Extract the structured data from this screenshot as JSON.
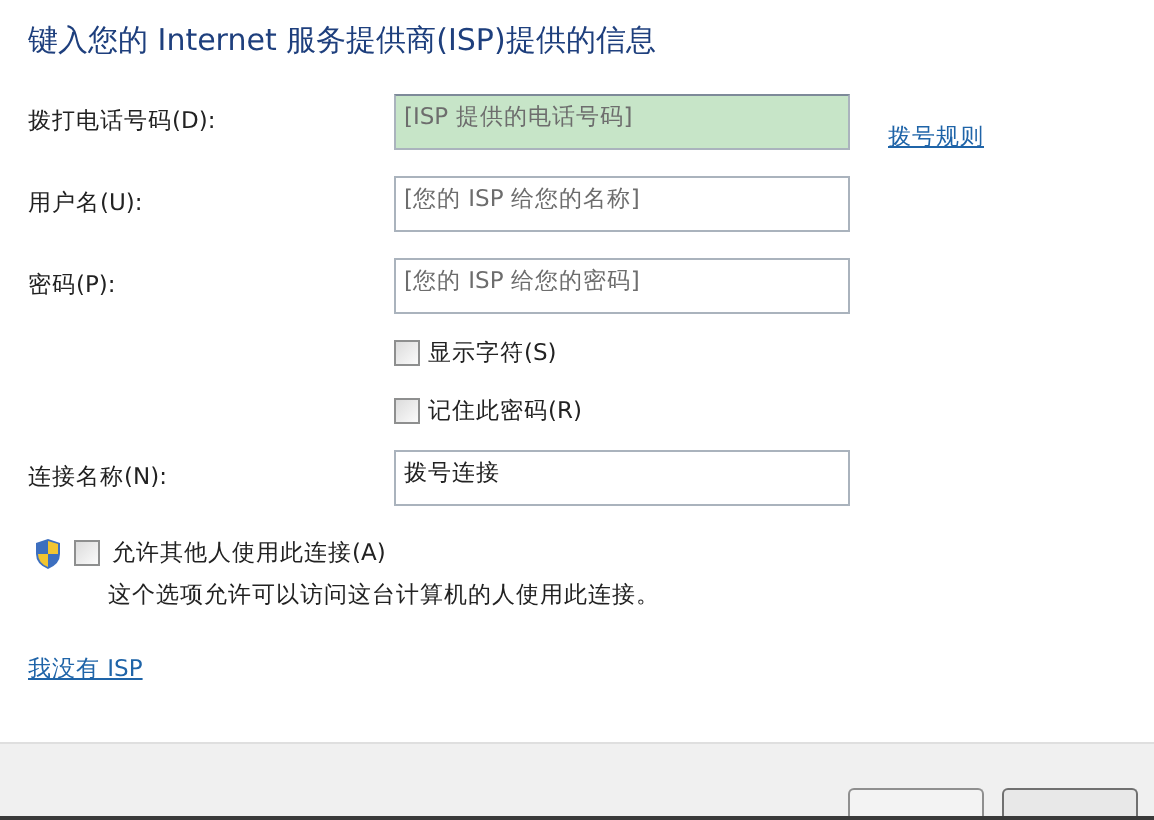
{
  "heading": "键入您的 Internet 服务提供商(ISP)提供的信息",
  "fields": [
    {
      "label": "拨打电话号码(D):",
      "placeholder": "[ISP 提供的电话号码]",
      "highlighted": true,
      "link": "拨号规则"
    },
    {
      "label": "用户名(U):",
      "placeholder": "[您的 ISP 给您的名称]",
      "highlighted": false
    },
    {
      "label": "密码(P):",
      "placeholder": "[您的 ISP 给您的密码]",
      "highlighted": false
    }
  ],
  "password_options": [
    {
      "label": "显示字符(S)",
      "checked": false
    },
    {
      "label": "记住此密码(R)",
      "checked": false
    }
  ],
  "connection_name": {
    "label": "连接名称(N):",
    "value": "拨号连接"
  },
  "allow_others": {
    "label": "允许其他人使用此连接(A)",
    "checked": false,
    "description": "这个选项允许可以访问这台计算机的人使用此连接。"
  },
  "no_isp_link": "我没有 ISP"
}
